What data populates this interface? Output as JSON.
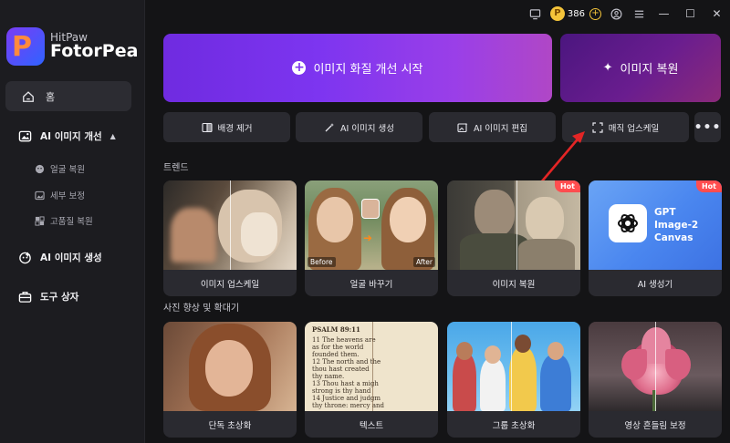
{
  "app": {
    "brand_top": "HitPaw",
    "brand_main": "FotorPea"
  },
  "topbar": {
    "credits": "386",
    "coin_symbol": "P",
    "icons": [
      "screen-icon",
      "coin-icon",
      "plus-icon",
      "user-icon",
      "menu-icon",
      "minimize-icon",
      "maximize-icon",
      "close-icon"
    ]
  },
  "sidebar": {
    "home": "홈",
    "ai_enhance": "AI 이미지 개선",
    "sub_items": [
      "얼굴 복원",
      "세부 보정",
      "고품질 복원"
    ],
    "ai_generate": "AI 이미지 생성",
    "toolbox": "도구 상자"
  },
  "hero": {
    "main_label": "이미지 화질 개선 시작",
    "side_label": "이미지 복원"
  },
  "tools": {
    "bg_remove": "배경 제거",
    "ai_generate": "AI 이미지 생성",
    "ai_edit": "AI 이미지 편집",
    "magic_upscale": "매직 업스케일",
    "more": "•••"
  },
  "sections": {
    "trend": "트렌드",
    "enhance": "사진 향상 및 확대기"
  },
  "trend_cards": [
    {
      "label": "이미지 업스케일"
    },
    {
      "label": "얼굴 바꾸기",
      "before": "Before",
      "after": "After"
    },
    {
      "label": "이미지 복원",
      "badge": "Hot"
    },
    {
      "label": "AI 생성기",
      "badge": "Hot",
      "gpt_text": "GPT Image-2 Canvas"
    }
  ],
  "enhance_cards": [
    {
      "label": "단독 초상화"
    },
    {
      "label": "텍스트",
      "psalm": "PSALM 89:11",
      "lines": [
        "11 The heavens are",
        "as for the world",
        "founded them.",
        "12 The north and the",
        "thou hast created",
        "thy name.",
        "13 Thou hast a migh",
        "strong is thy hand",
        "14 Justice and judgm",
        "thy throne: mercy and"
      ]
    },
    {
      "label": "그룹 초상화"
    },
    {
      "label": "영상 흔들림 보정"
    }
  ],
  "colors": {
    "accent_purple": "#7d35f0",
    "hot_red": "#ff4d4f",
    "coin_gold": "#f4c43a"
  }
}
